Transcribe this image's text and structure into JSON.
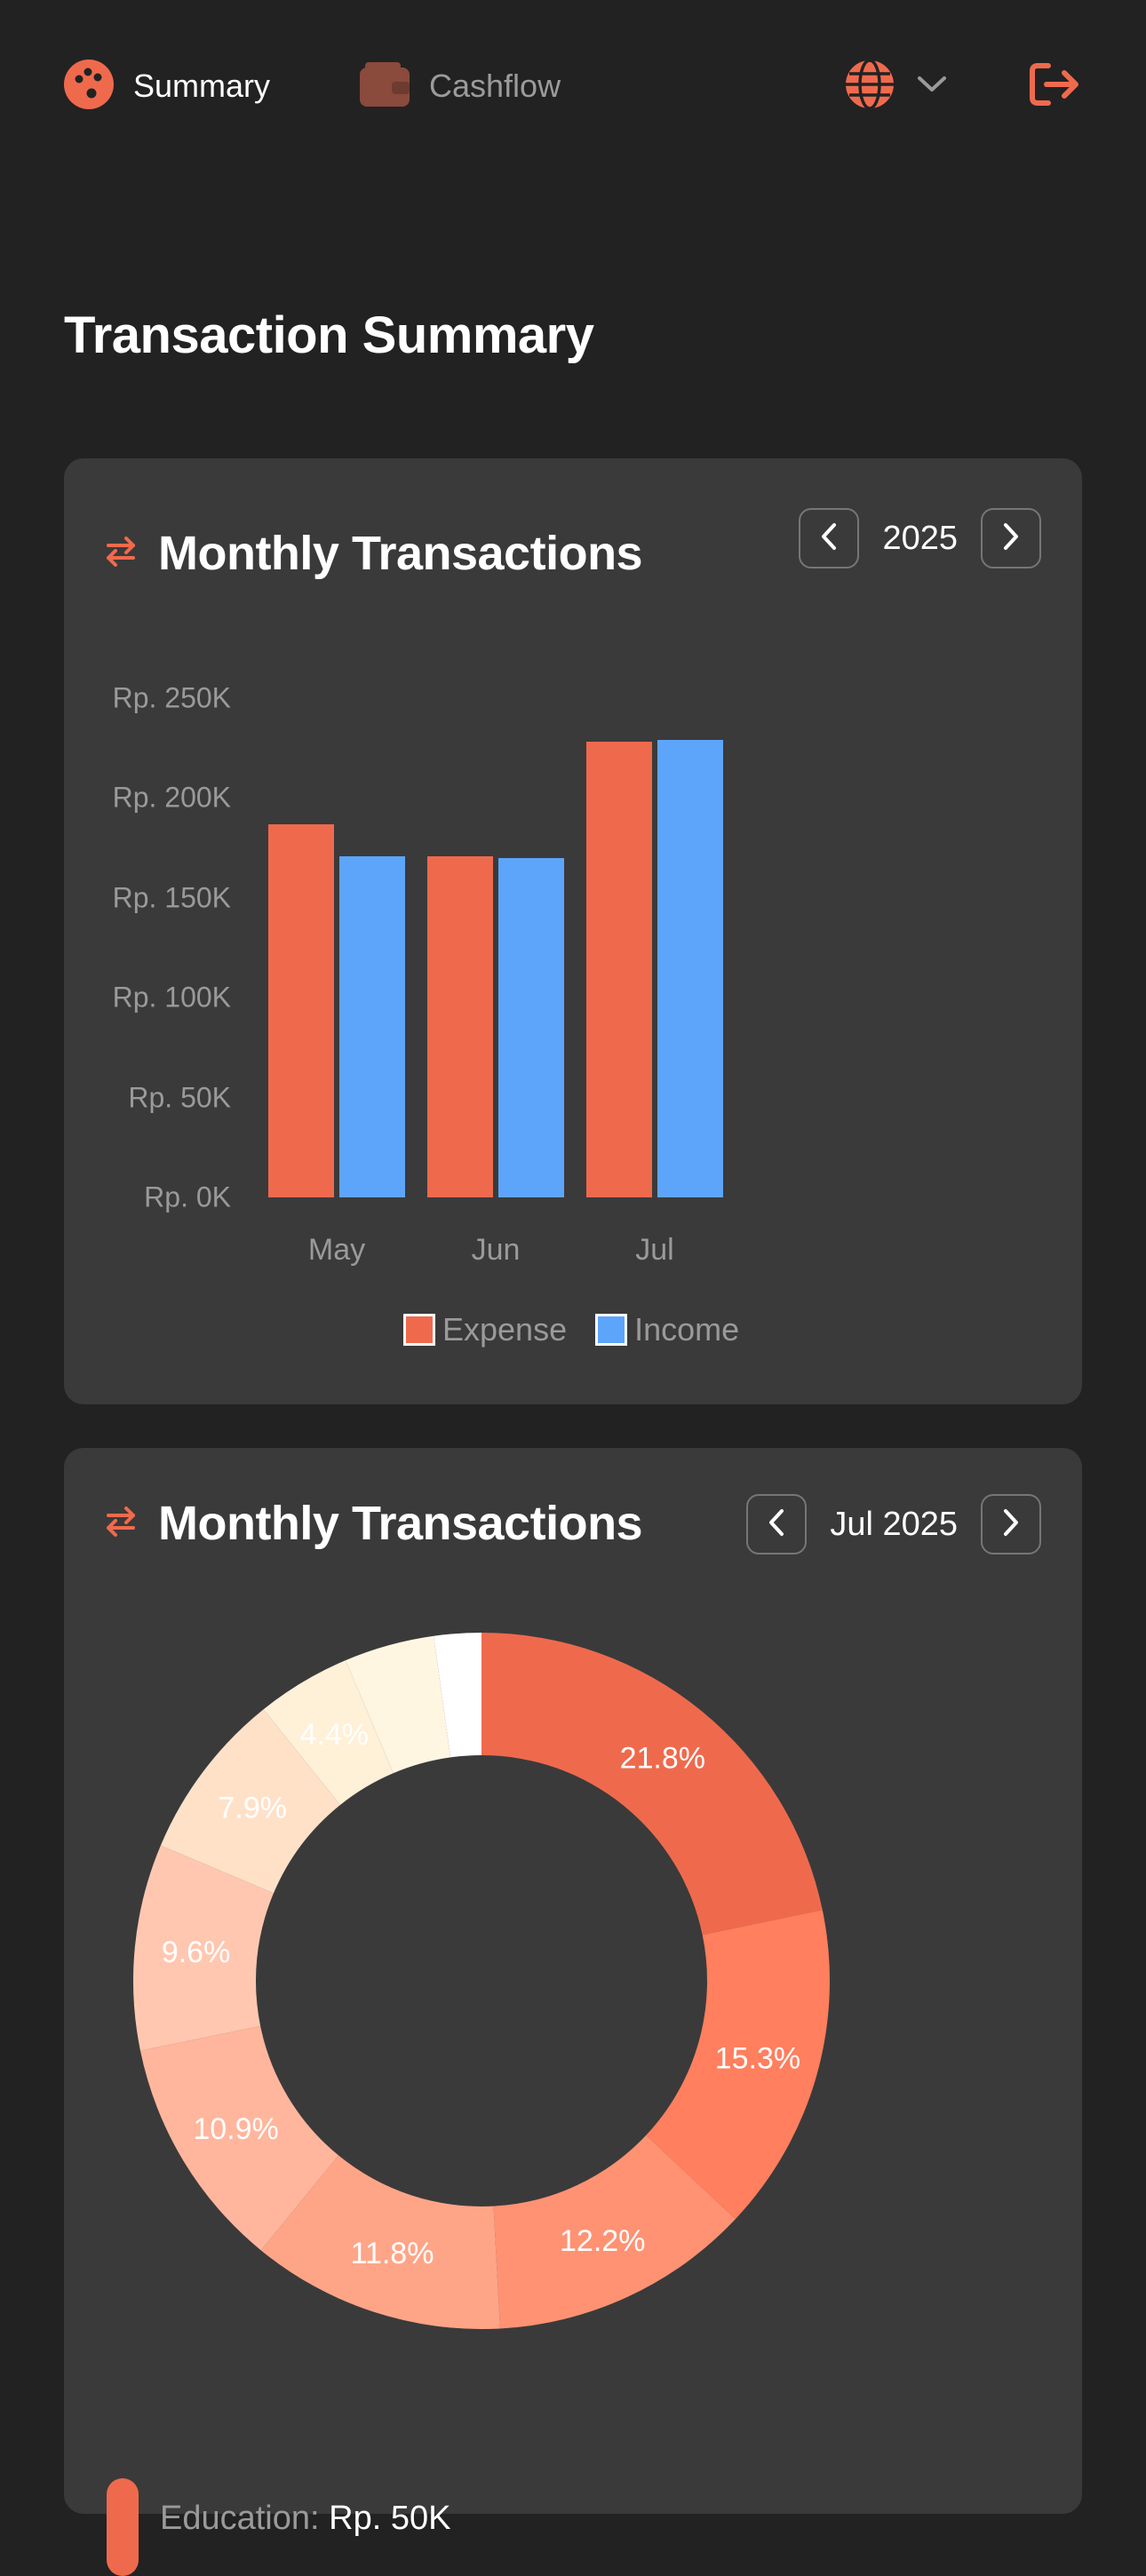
{
  "nav": {
    "summary_label": "Summary",
    "cashflow_label": "Cashflow",
    "icons": {
      "summary": "palette-icon",
      "cashflow": "wallet-icon",
      "language": "globe-icon",
      "dropdown": "chevron-down-icon",
      "logout": "logout-icon"
    }
  },
  "page": {
    "title": "Transaction Summary"
  },
  "colors": {
    "accent": "#EF6A4D",
    "income": "#5DA5FB",
    "card": "#3A3A3B",
    "background": "#222223"
  },
  "card1": {
    "title": "Monthly Transactions",
    "icon": "swap-arrows-icon",
    "period": "2025"
  },
  "card2": {
    "title": "Monthly Transactions",
    "icon": "swap-arrows-icon",
    "period": "Jul 2025",
    "category_label": "Education:",
    "category_amount": "Rp. 50K"
  },
  "chart_data": [
    {
      "type": "bar",
      "categories": [
        "May",
        "Jun",
        "Jul"
      ],
      "series": [
        {
          "name": "Expense",
          "values": [
            187000,
            171000,
            228000
          ],
          "color": "#EF6A4D"
        },
        {
          "name": "Income",
          "values": [
            171000,
            170000,
            229000
          ],
          "color": "#5DA5FB"
        }
      ],
      "yticks": [
        "Rp. 0K",
        "Rp. 50K",
        "Rp. 100K",
        "Rp. 150K",
        "Rp. 200K",
        "Rp. 250K"
      ],
      "ylim": [
        0,
        250000
      ],
      "legend": "bottom"
    },
    {
      "type": "pie",
      "donut": true,
      "slices": [
        {
          "label": "21.8%",
          "value": 21.8,
          "color": "#EF6A4D"
        },
        {
          "label": "15.3%",
          "value": 15.3,
          "color": "#FF7F5E"
        },
        {
          "label": "12.2%",
          "value": 12.2,
          "color": "#FF9273"
        },
        {
          "label": "11.8%",
          "value": 11.8,
          "color": "#FFA587"
        },
        {
          "label": "10.9%",
          "value": 10.9,
          "color": "#FFB69C"
        },
        {
          "label": "9.6%",
          "value": 9.6,
          "color": "#FFC7B0"
        },
        {
          "label": "7.9%",
          "value": 7.9,
          "color": "#FFE1C8"
        },
        {
          "label": "4.4%",
          "value": 4.4,
          "color": "#FFF0D8"
        },
        {
          "label": "",
          "value": 4.2,
          "color": "#FFF6E2"
        },
        {
          "label": "",
          "value": 2.2,
          "color": "#FFFFFF"
        }
      ]
    }
  ]
}
